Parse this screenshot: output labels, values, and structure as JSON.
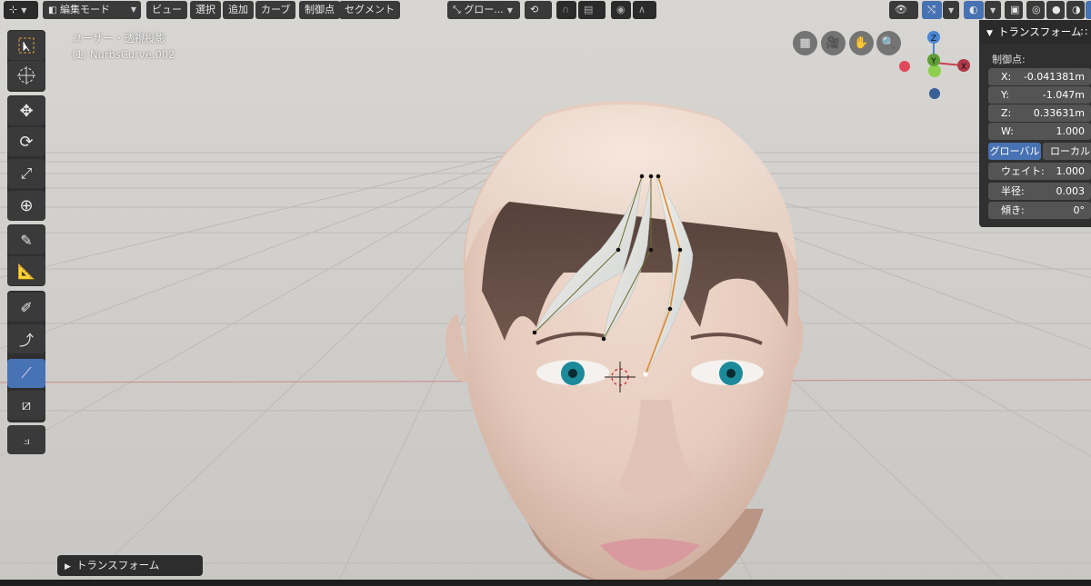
{
  "header": {
    "editor_type_icon": "3d-view-icon",
    "mode": "編集モード",
    "menus": [
      "ビュー",
      "選択",
      "追加",
      "カーブ",
      "制御点",
      "セグメント"
    ],
    "orientation": "グロー..."
  },
  "overlay": {
    "view_name": "ユーザー・透視投影",
    "object_name": "(1) NurbsCurve.002"
  },
  "toolbar": {
    "tools": [
      "select-box-icon",
      "cursor-icon",
      "move-icon",
      "rotate-icon",
      "scale-icon",
      "transform-icon",
      "annotate-icon",
      "measure-icon",
      "draw-icon",
      "pen-icon",
      "tilt-icon",
      "radius-icon",
      "randomize-icon",
      "extrude-icon"
    ],
    "active_tool": "tilt-icon"
  },
  "gizmo": {
    "z": "Z",
    "y": "Y",
    "x": "X"
  },
  "npanel": {
    "title": "トランスフォーム",
    "section": "制御点:",
    "x_label": "X:",
    "x": "-0.041381m",
    "y_label": "Y:",
    "y": "-1.047m",
    "z_label": "Z:",
    "z": "0.33631m",
    "w_label": "W:",
    "w": "1.000",
    "global": "グローバル",
    "local": "ローカル",
    "weight_label": "ウェイト:",
    "weight": "1.000",
    "radius_label": "半径:",
    "radius": "0.003",
    "tilt_label": "傾き:",
    "tilt": "0°"
  },
  "operator_panel": {
    "title": "トランスフォーム"
  },
  "colors": {
    "accent": "#4772b3",
    "x_axis": "#c9444f",
    "y_axis": "#7ec242",
    "z_axis": "#4a86d6",
    "curve_active": "#e08a2c"
  }
}
